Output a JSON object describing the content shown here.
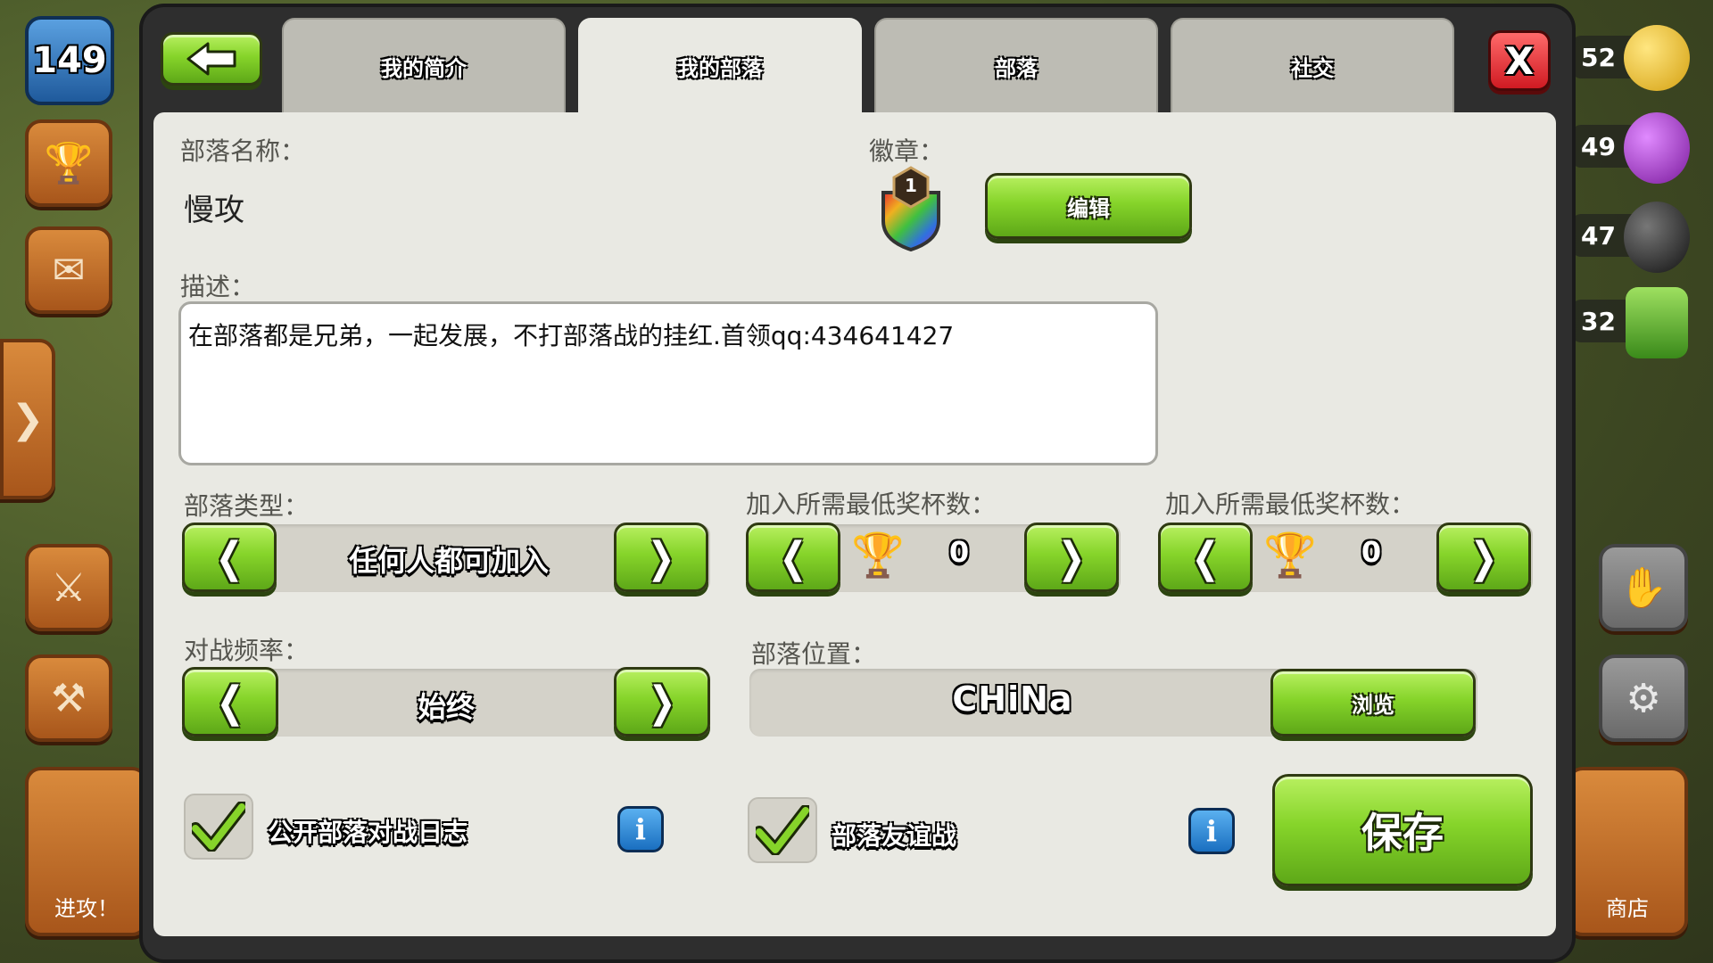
{
  "hud": {
    "level": "149",
    "attack_label": "进攻！",
    "shop_label": "商店",
    "resources": [
      "52",
      "49",
      "47",
      "32"
    ]
  },
  "tabs": [
    {
      "label": "我的简介",
      "active": false
    },
    {
      "label": "我的部落",
      "active": true
    },
    {
      "label": "部落",
      "active": false
    },
    {
      "label": "社交",
      "active": false
    }
  ],
  "close_icon": "X",
  "back_icon": "back-arrow-icon",
  "form": {
    "clan_name_label": "部落名称：",
    "clan_name_value": "慢攻",
    "badge_label": "徽章：",
    "badge_level": "1",
    "edit_button": "编辑",
    "description_label": "描述：",
    "description_value": "在部落都是兄弟，一起发展，不打部落战的挂红.首领qq:434641427",
    "clan_type_label": "部落类型：",
    "clan_type_value": "任何人都可加入",
    "min_trophies_label": "加入所需最低奖杯数：",
    "min_trophies_value": "0",
    "min_trophies_label_2": "加入所需最低奖杯数：",
    "min_trophies_value_2": "0",
    "war_frequency_label": "对战频率：",
    "war_frequency_value": "始终",
    "location_label": "部落位置：",
    "location_value": "CHiNa",
    "browse_button": "浏览",
    "public_war_log_label": "公开部落对战日志",
    "friendly_war_label": "部落友谊战",
    "info_icon": "i",
    "save_button": "保存",
    "prev_glyph": "❬",
    "next_glyph": "❭"
  },
  "colors": {
    "accent_green": "#86d42a",
    "panel_bg": "#e9e9e3",
    "close_red": "#e0202a"
  }
}
